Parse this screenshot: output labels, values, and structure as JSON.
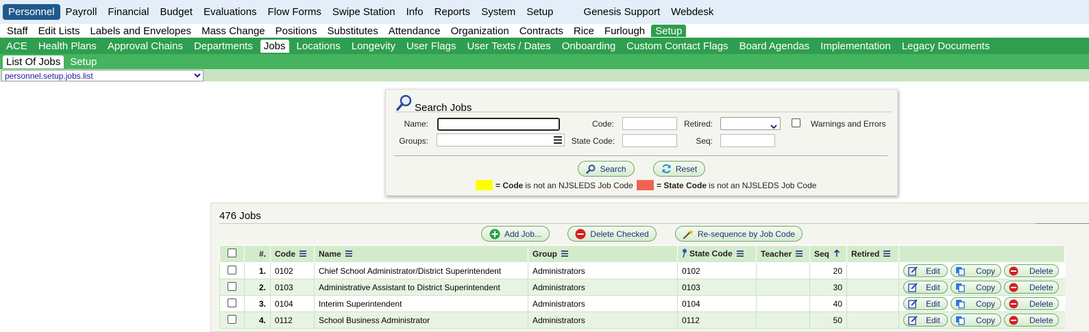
{
  "top_menu": {
    "items": [
      "Personnel",
      "Payroll",
      "Financial",
      "Budget",
      "Evaluations",
      "Flow Forms",
      "Swipe Station",
      "Info",
      "Reports",
      "System",
      "Setup"
    ],
    "extra": [
      "Genesis Support",
      "Webdesk"
    ],
    "active": "Personnel"
  },
  "sub_menu": {
    "items": [
      "Staff",
      "Edit Lists",
      "Labels and Envelopes",
      "Mass Change",
      "Positions",
      "Substitutes",
      "Attendance",
      "Organization",
      "Contracts",
      "Rice",
      "Furlough",
      "Setup"
    ],
    "active": "Setup"
  },
  "setup_tabs": {
    "items": [
      "ACE",
      "Health Plans",
      "Approval Chains",
      "Departments",
      "Jobs",
      "Locations",
      "Longevity",
      "User Flags",
      "User Texts / Dates",
      "Onboarding",
      "Custom Contact Flags",
      "Board Agendas",
      "Implementation",
      "Legacy Documents"
    ],
    "active": "Jobs"
  },
  "jobs_tabs": {
    "items": [
      "List Of Jobs",
      "Setup"
    ],
    "active": "List Of Jobs"
  },
  "path_select": {
    "value": "personnel.setup.jobs.list"
  },
  "search": {
    "title": "Search Jobs",
    "name_label": "Name:",
    "groups_label": "Groups:",
    "code_label": "Code:",
    "state_code_label": "State Code:",
    "retired_label": "Retired:",
    "seq_label": "Seq:",
    "warnings_label": "Warnings and Errors",
    "search_button": "Search",
    "reset_button": "Reset",
    "legend_code_bold": "= Code",
    "legend_code_rest": "is not an NJSLEDS Job Code",
    "legend_state_bold": "= State Code",
    "legend_state_rest": "is not an NJSLEDS Job Code",
    "legend_code_color": "#ffff00",
    "legend_state_color": "#ef6451"
  },
  "jobs": {
    "count_label": "476 Jobs",
    "add_button": "Add Job...",
    "delete_checked_button": "Delete Checked",
    "resequence_button": "Re-sequence by Job Code",
    "columns": {
      "num": "#.",
      "code": "Code",
      "name": "Name",
      "group": "Group",
      "state_code": "State Code",
      "teacher": "Teacher",
      "seq": "Seq",
      "retired": "Retired"
    },
    "row_actions": {
      "edit": "Edit",
      "copy": "Copy",
      "delete": "Delete"
    },
    "rows": [
      {
        "num": "1.",
        "code": "0102",
        "name": "Chief School Administrator/District Superintendent",
        "group": "Administrators",
        "state_code": "0102",
        "teacher": "",
        "seq": "20",
        "retired": ""
      },
      {
        "num": "2.",
        "code": "0103",
        "name": "Administrative Assistant to District Superintendent",
        "group": "Administrators",
        "state_code": "0103",
        "teacher": "",
        "seq": "30",
        "retired": ""
      },
      {
        "num": "3.",
        "code": "0104",
        "name": "Interim Superintendent",
        "group": "Administrators",
        "state_code": "0104",
        "teacher": "",
        "seq": "40",
        "retired": ""
      },
      {
        "num": "4.",
        "code": "0112",
        "name": "School Business Administrator",
        "group": "Administrators",
        "state_code": "0112",
        "teacher": "",
        "seq": "50",
        "retired": ""
      }
    ]
  },
  "colors": {
    "top_active": "#205a8c",
    "green_bar": "#2e9e4f",
    "light_green_bar": "#45b35f",
    "header_row": "#d4ebcb",
    "alt_row": "#e8f4e3"
  }
}
